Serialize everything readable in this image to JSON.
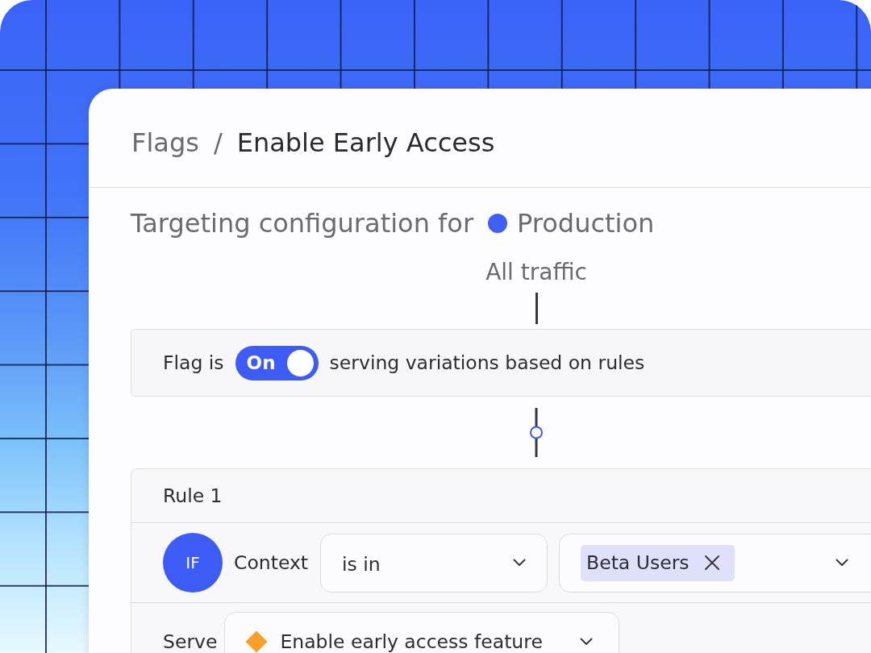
{
  "breadcrumb": {
    "items": [
      {
        "label": "Flags",
        "current": false
      },
      {
        "label": "Enable Early Access",
        "current": true
      }
    ],
    "separator": "/"
  },
  "targeting": {
    "label": "Targeting configuration for",
    "environment": {
      "name": "Production",
      "color": "#3f5ff5"
    }
  },
  "flow": {
    "start_label": "All traffic"
  },
  "flag_status": {
    "prefix": "Flag is",
    "toggle": {
      "on": true,
      "label": "On"
    },
    "description": "serving variations based on rules"
  },
  "rules": [
    {
      "title": "Rule 1",
      "condition": {
        "badge": "IF",
        "attribute": "Context",
        "operator": "is in",
        "values": [
          {
            "label": "Beta Users"
          }
        ]
      },
      "serve": {
        "label": "Serve",
        "variation": {
          "name": "Enable early access feature",
          "color": "#f89e2a"
        }
      }
    }
  ]
}
